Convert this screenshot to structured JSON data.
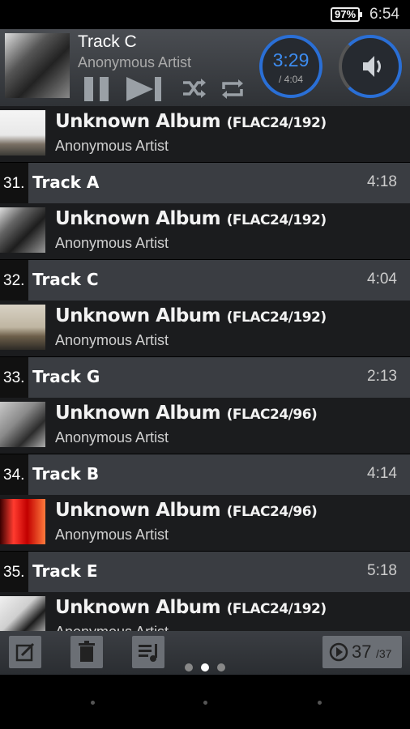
{
  "status": {
    "battery": "97%",
    "time": "6:54"
  },
  "now_playing": {
    "title": "Track C",
    "artist": "Anonymous Artist",
    "elapsed": "3:29",
    "total": "/ 4:04",
    "accent": "#2a6fd6"
  },
  "entries": [
    {
      "album": "Unknown Album",
      "format": "(FLAC24/192)",
      "artist": "Anonymous Artist",
      "num": "31.",
      "track": "Track A",
      "duration": "4:18",
      "thumb": "linear-gradient(#f5f5f5 0%,#e8e8e8 55%,#7a7064 75%,#3b3a36 100%)"
    },
    {
      "album": "Unknown Album",
      "format": "(FLAC24/192)",
      "artist": "Anonymous Artist",
      "num": "32.",
      "track": "Track C",
      "duration": "4:04",
      "thumb": "linear-gradient(135deg,#ddd 0%,#666 30%,#1d1d1d 60%,#999 100%)"
    },
    {
      "album": "Unknown Album",
      "format": "(FLAC24/192)",
      "artist": "Anonymous Artist",
      "num": "33.",
      "track": "Track G",
      "duration": "2:13",
      "thumb": "linear-gradient(#d8d2c4 0%,#bfb6a2 50%,#6d5f4a 70%,#2d2a26 100%)"
    },
    {
      "album": "Unknown Album",
      "format": "(FLAC24/96)",
      "artist": "Anonymous Artist",
      "num": "34.",
      "track": "Track B",
      "duration": "4:14",
      "thumb": "linear-gradient(135deg,#c9c9c9 0%,#8a8a8a 40%,#2c2c2c 70%,#b0b0b0 100%)"
    },
    {
      "album": "Unknown Album",
      "format": "(FLAC24/96)",
      "artist": "Anonymous Artist",
      "num": "35.",
      "track": "Track E",
      "duration": "5:18",
      "thumb": "linear-gradient(90deg,#3a0000 0%,#ff3b2f 30%,#c20000 60%,#ff7a3c 100%)"
    },
    {
      "album": "Unknown Album",
      "format": "(FLAC24/192)",
      "artist": "Anonymous Artist",
      "num": "",
      "track": "",
      "duration": "",
      "thumb": "linear-gradient(135deg,#f0f0f0 0%,#cfcfcf 40%,#1d1d1d 65%,#e6e6e6 100%)"
    }
  ],
  "toolbar": {
    "count_current": "37",
    "count_total": "/37"
  }
}
